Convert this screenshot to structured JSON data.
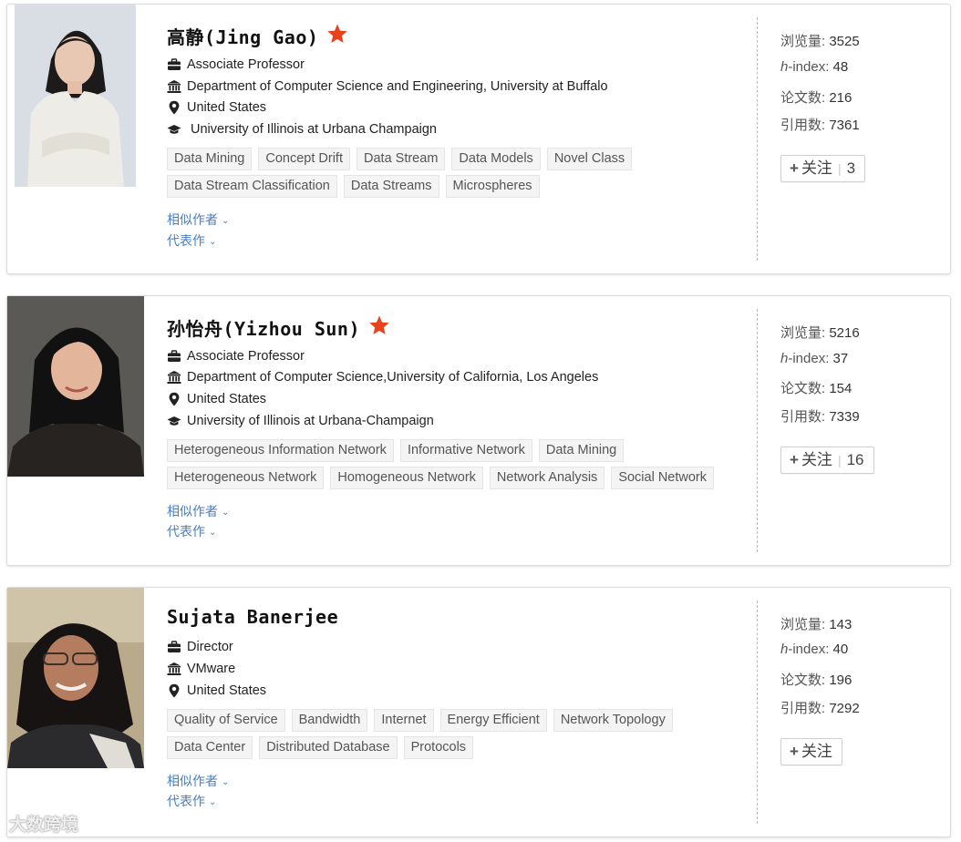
{
  "colors": {
    "accent_star": "#e8411c",
    "link": "#4a7fbe",
    "tag_bg": "#f4f4f4"
  },
  "icons": {
    "position": "briefcase-icon",
    "org": "institution-icon",
    "location": "map-pin-icon",
    "education": "graduation-cap-icon",
    "favorite": "star-icon",
    "follow": "plus-icon"
  },
  "scholars": [
    {
      "name": "高静(Jing Gao)",
      "starred": true,
      "position": "Associate Professor",
      "organization": "Department of Computer Science and Engineering, University at Buffalo",
      "location": "United States",
      "education": "University of Illinois at Urbana Champaign",
      "tags_row1": [
        "Data Mining",
        "Concept Drift",
        "Data Stream",
        "Data Models",
        "Novel Class"
      ],
      "tags_row2": [
        "Data Stream Classification",
        "Data Streams",
        "Microspheres"
      ],
      "similar_authors": "相似作者",
      "representative_works": "代表作",
      "stats": {
        "views_label": "浏览量:",
        "views": "3525",
        "hindex_label_italic": "h",
        "hindex_label_rest": "-index:",
        "hindex": "48",
        "papers_label": "论文数:",
        "papers": "216",
        "citations_label": "引用数:",
        "citations": "7361"
      },
      "follow_label": "关注",
      "follow_count": "3"
    },
    {
      "name": "孙怡舟(Yizhou Sun)",
      "starred": true,
      "position": "Associate Professor",
      "organization": "Department of Computer Science,University of California, Los Angeles",
      "location": "United States",
      "education": "University of Illinois at Urbana-Champaign",
      "tags_row1": [
        "Heterogeneous Information Network",
        "Informative Network",
        "Data Mining"
      ],
      "tags_row2": [
        "Heterogeneous Network",
        "Homogeneous Network",
        "Network Analysis",
        "Social Network"
      ],
      "similar_authors": "相似作者",
      "representative_works": "代表作",
      "stats": {
        "views_label": "浏览量:",
        "views": "5216",
        "hindex_label_italic": "h",
        "hindex_label_rest": "-index:",
        "hindex": "37",
        "papers_label": "论文数:",
        "papers": "154",
        "citations_label": "引用数:",
        "citations": "7339"
      },
      "follow_label": "关注",
      "follow_count": "16"
    },
    {
      "name": "Sujata Banerjee",
      "starred": false,
      "position": "Director",
      "organization": "VMware",
      "location": "United States",
      "tags_row1": [
        "Quality of Service",
        "Bandwidth",
        "Internet",
        "Energy Efficient",
        "Network Topology"
      ],
      "tags_row2": [
        "Data Center",
        "Distributed Database",
        "Protocols"
      ],
      "similar_authors": "相似作者",
      "representative_works": "代表作",
      "stats": {
        "views_label": "浏览量:",
        "views": "143",
        "hindex_label_italic": "h",
        "hindex_label_rest": "-index:",
        "hindex": "40",
        "papers_label": "论文数:",
        "papers": "196",
        "citations_label": "引用数:",
        "citations": "7292"
      },
      "follow_label": "关注"
    }
  ],
  "watermark": "大数跨境"
}
